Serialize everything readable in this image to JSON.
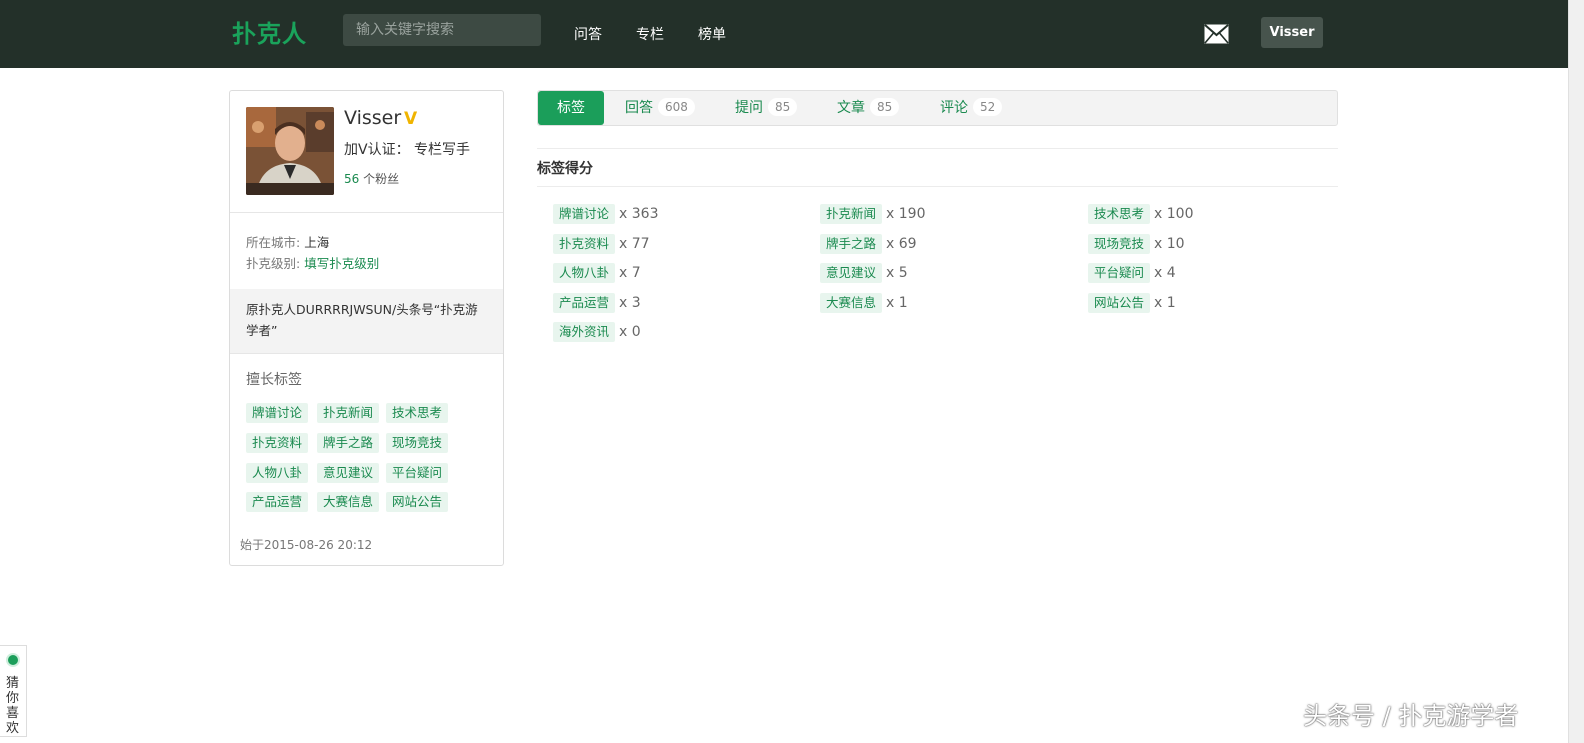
{
  "header": {
    "logo": "扑克人",
    "search_placeholder": "输入关键字搜索",
    "nav": [
      "问答",
      "专栏",
      "榜单"
    ],
    "user_button": "Visser",
    "mail_icon": "mail-icon"
  },
  "profile": {
    "name": "Visser",
    "v_badge": "V",
    "verify_label": "加V认证：",
    "verify_value": "专栏写手",
    "fans_count": "56",
    "fans_label": " 个粉丝",
    "city_label": "所在城市: ",
    "city_value": "上海",
    "level_label": "扑克级别: ",
    "level_link": "填写扑克级别",
    "bio": "原扑克人DURRRRJWSUN/头条号“扑克游学者”",
    "tags_title": "擅长标签",
    "tags": [
      "牌谱讨论",
      "扑克新闻",
      "技术思考",
      "扑克资料",
      "牌手之路",
      "现场竞技",
      "人物八卦",
      "意见建议",
      "平台疑问",
      "产品运营",
      "大赛信息",
      "网站公告"
    ],
    "since": "始于2015-08-26 20:12"
  },
  "tabs": [
    {
      "label": "标签",
      "count": ""
    },
    {
      "label": "回答",
      "count": "608"
    },
    {
      "label": "提问",
      "count": "85"
    },
    {
      "label": "文章",
      "count": "85"
    },
    {
      "label": "评论",
      "count": "52"
    }
  ],
  "section_title": "标签得分",
  "scores": [
    {
      "tag": "牌谱讨论",
      "score": "x 363"
    },
    {
      "tag": "扑克新闻",
      "score": "x 190"
    },
    {
      "tag": "技术思考",
      "score": "x 100"
    },
    {
      "tag": "扑克资料",
      "score": "x 77"
    },
    {
      "tag": "牌手之路",
      "score": "x 69"
    },
    {
      "tag": "现场竞技",
      "score": "x 10"
    },
    {
      "tag": "人物八卦",
      "score": "x 7"
    },
    {
      "tag": "意见建议",
      "score": "x 5"
    },
    {
      "tag": "平台疑问",
      "score": "x 4"
    },
    {
      "tag": "产品运营",
      "score": "x 3"
    },
    {
      "tag": "大赛信息",
      "score": "x 1"
    },
    {
      "tag": "网站公告",
      "score": "x 1"
    },
    {
      "tag": "海外资讯",
      "score": "x 0"
    }
  ],
  "side_widget": "猜你喜欢",
  "watermark": "头条号 / 扑克游学者",
  "colors": {
    "accent": "#1b9e5a",
    "topbar": "#233029",
    "tag_bg": "#e8f5ee"
  }
}
